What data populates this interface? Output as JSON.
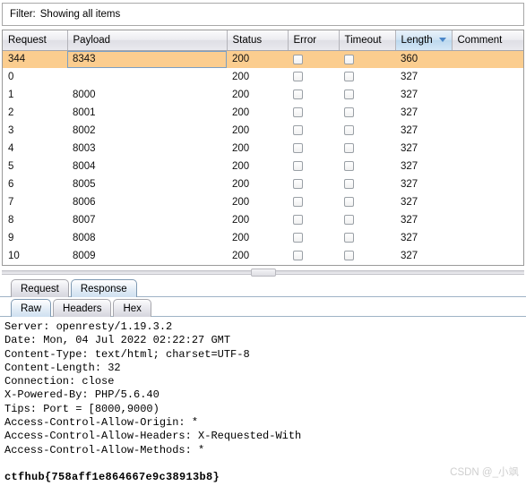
{
  "filter": {
    "label": "Filter:",
    "value": "Showing all items"
  },
  "results_table": {
    "columns": [
      {
        "key": "request",
        "label": "Request",
        "sorted": false
      },
      {
        "key": "payload",
        "label": "Payload",
        "sorted": false
      },
      {
        "key": "status",
        "label": "Status",
        "sorted": false
      },
      {
        "key": "error",
        "label": "Error",
        "sorted": false
      },
      {
        "key": "timeout",
        "label": "Timeout",
        "sorted": false
      },
      {
        "key": "length",
        "label": "Length",
        "sorted": true,
        "sort_direction": "descending"
      },
      {
        "key": "comment",
        "label": "Comment",
        "sorted": false
      }
    ],
    "rows": [
      {
        "request": "344",
        "payload": "8343",
        "status": "200",
        "error": false,
        "timeout": false,
        "length": "360",
        "comment": "",
        "selected": true
      },
      {
        "request": "0",
        "payload": "",
        "status": "200",
        "error": false,
        "timeout": false,
        "length": "327",
        "comment": "",
        "selected": false
      },
      {
        "request": "1",
        "payload": "8000",
        "status": "200",
        "error": false,
        "timeout": false,
        "length": "327",
        "comment": "",
        "selected": false
      },
      {
        "request": "2",
        "payload": "8001",
        "status": "200",
        "error": false,
        "timeout": false,
        "length": "327",
        "comment": "",
        "selected": false
      },
      {
        "request": "3",
        "payload": "8002",
        "status": "200",
        "error": false,
        "timeout": false,
        "length": "327",
        "comment": "",
        "selected": false
      },
      {
        "request": "4",
        "payload": "8003",
        "status": "200",
        "error": false,
        "timeout": false,
        "length": "327",
        "comment": "",
        "selected": false
      },
      {
        "request": "5",
        "payload": "8004",
        "status": "200",
        "error": false,
        "timeout": false,
        "length": "327",
        "comment": "",
        "selected": false
      },
      {
        "request": "6",
        "payload": "8005",
        "status": "200",
        "error": false,
        "timeout": false,
        "length": "327",
        "comment": "",
        "selected": false
      },
      {
        "request": "7",
        "payload": "8006",
        "status": "200",
        "error": false,
        "timeout": false,
        "length": "327",
        "comment": "",
        "selected": false
      },
      {
        "request": "8",
        "payload": "8007",
        "status": "200",
        "error": false,
        "timeout": false,
        "length": "327",
        "comment": "",
        "selected": false
      },
      {
        "request": "9",
        "payload": "8008",
        "status": "200",
        "error": false,
        "timeout": false,
        "length": "327",
        "comment": "",
        "selected": false
      },
      {
        "request": "10",
        "payload": "8009",
        "status": "200",
        "error": false,
        "timeout": false,
        "length": "327",
        "comment": "",
        "selected": false
      }
    ]
  },
  "message_tabs": {
    "outer": [
      {
        "label": "Request",
        "active": false
      },
      {
        "label": "Response",
        "active": true
      }
    ],
    "inner": [
      {
        "label": "Raw",
        "active": true
      },
      {
        "label": "Headers",
        "active": false
      },
      {
        "label": "Hex",
        "active": false
      }
    ]
  },
  "response": {
    "headers": [
      "Server: openresty/1.19.3.2",
      "Date: Mon, 04 Jul 2022 02:22:27 GMT",
      "Content-Type: text/html; charset=UTF-8",
      "Content-Length: 32",
      "Connection: close",
      "X-Powered-By: PHP/5.6.40",
      "Tips: Port = [8000,9000)",
      "Access-Control-Allow-Origin: *",
      "Access-Control-Allow-Headers: X-Requested-With",
      "Access-Control-Allow-Methods: *"
    ],
    "body": "ctfhub{758aff1e864667e9c38913b8}"
  },
  "watermark": "CSDN @_小飒",
  "colors": {
    "selected_row": "#fbcd8f",
    "sorted_header": "#cfe3f3",
    "focus_border": "#7a9fc4"
  }
}
